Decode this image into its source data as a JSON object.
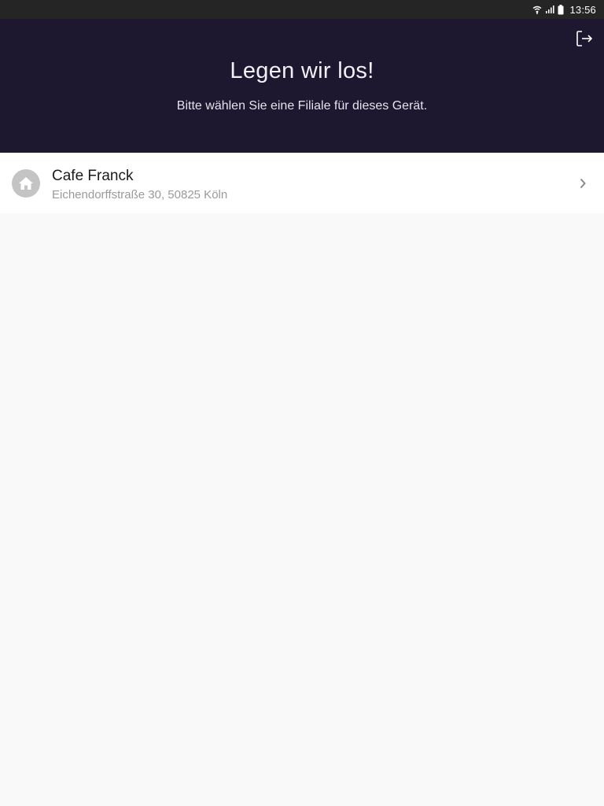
{
  "status_bar": {
    "time": "13:56",
    "icons": [
      "wifi-icon",
      "signal-icon",
      "battery-icon"
    ]
  },
  "header": {
    "title": "Legen wir los!",
    "subtitle": "Bitte wählen Sie eine Filiale für dieses Gerät.",
    "background_color": "#1e1730",
    "logout_icon": "logout-icon"
  },
  "branches": [
    {
      "name": "Cafe Franck",
      "address": "Eichendorffstraße 30, 50825 Köln",
      "icon": "home-icon",
      "action_icon": "chevron-right-icon"
    }
  ]
}
